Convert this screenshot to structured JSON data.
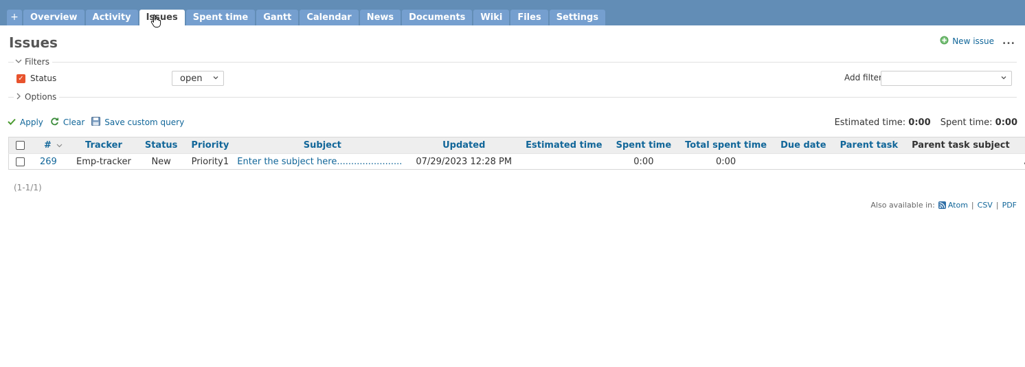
{
  "tabs": [
    {
      "label": "+"
    },
    {
      "label": "Overview"
    },
    {
      "label": "Activity"
    },
    {
      "label": "Issues",
      "selected": true
    },
    {
      "label": "Spent time"
    },
    {
      "label": "Gantt"
    },
    {
      "label": "Calendar"
    },
    {
      "label": "News"
    },
    {
      "label": "Documents"
    },
    {
      "label": "Wiki"
    },
    {
      "label": "Files"
    },
    {
      "label": "Settings"
    }
  ],
  "page": {
    "title": "Issues",
    "new_issue_label": "New issue",
    "more_label": "..."
  },
  "filters": {
    "legend": "Filters",
    "status_label": "Status",
    "status_checked": true,
    "status_value": "open",
    "add_filter_label": "Add filter",
    "add_filter_value": ""
  },
  "options": {
    "legend": "Options"
  },
  "buttons": {
    "apply": "Apply",
    "clear": "Clear",
    "save": "Save custom query"
  },
  "totals": {
    "estimated_label": "Estimated time:",
    "estimated_value": "0:00",
    "spent_label": "Spent time:",
    "spent_value": "0:00"
  },
  "table": {
    "headers": {
      "id": "#",
      "tracker": "Tracker",
      "status": "Status",
      "priority": "Priority",
      "subject": "Subject",
      "updated": "Updated",
      "estimated": "Estimated time",
      "spent": "Spent time",
      "total_spent": "Total spent time",
      "due": "Due date",
      "parent": "Parent task",
      "parent_subject": "Parent task subject"
    },
    "rows": [
      {
        "id": "269",
        "tracker": "Emp-tracker",
        "status": "New",
        "priority": "Priority1",
        "subject": "Enter the subject here.......................",
        "updated": "07/29/2023 12:28 PM",
        "estimated": "",
        "spent": "0:00",
        "total_spent": "0:00",
        "due": "",
        "parent": "",
        "parent_subject": "",
        "actions": "..."
      }
    ]
  },
  "pagination": "(1-1/1)",
  "formats": {
    "label": "Also available in:",
    "atom": "Atom",
    "csv": "CSV",
    "pdf": "PDF",
    "separator": "|"
  },
  "colors": {
    "header_bg": "#628db6",
    "tab_bg": "#759fcf",
    "link": "#116699",
    "checkbox_checked": "#e8532d"
  }
}
